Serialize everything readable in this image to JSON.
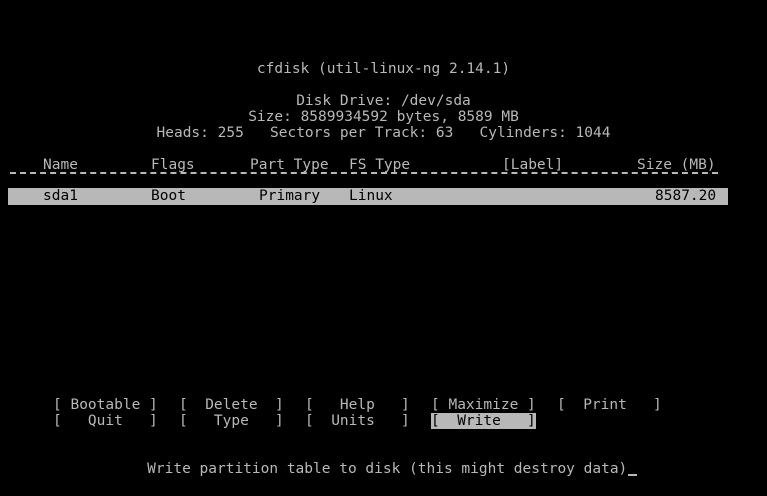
{
  "header": {
    "title": "cfdisk (util-linux-ng 2.14.1)",
    "disk_drive": "Disk Drive: /dev/sda",
    "size_line": "Size: 8589934592 bytes, 8589 MB",
    "geometry_line": "Heads: 255   Sectors per Track: 63   Cylinders: 1044"
  },
  "table": {
    "columns": {
      "name": "Name",
      "flags": "Flags",
      "part_type": "Part Type",
      "fs_type": "FS Type",
      "label": "[Label]",
      "size": "Size (MB)"
    },
    "rows": [
      {
        "name": "sda1",
        "flags": "Boot",
        "part_type": "Primary",
        "fs_type": "Linux",
        "label": "",
        "size": "8587.20"
      }
    ]
  },
  "menu": {
    "bootable": "[ Bootable ]",
    "delete": "[  Delete  ]",
    "help": "[   Help   ]",
    "maximize": "[ Maximize ]",
    "print": "[  Print   ]",
    "quit": "[   Quit   ]",
    "type": "[   Type   ]",
    "units": "[  Units   ]",
    "write": "[  Write   ]"
  },
  "status": {
    "message": "Write partition table to disk (this might destroy data)"
  },
  "colors": {
    "background": "#000000",
    "foreground": "#b8b8b8"
  }
}
